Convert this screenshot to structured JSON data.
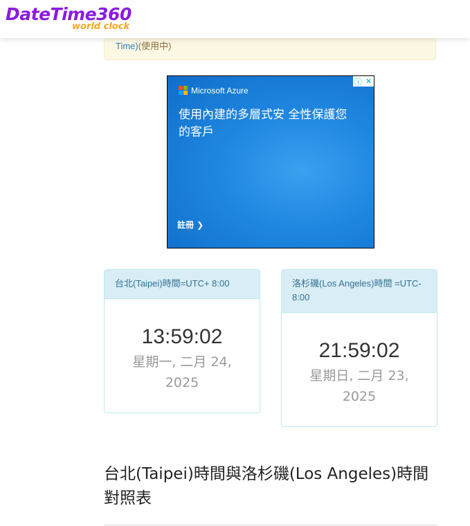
{
  "header": {
    "logo_main": "DateTime360",
    "logo_sub": "world clock"
  },
  "notice": {
    "link_text": "Time)",
    "status_text": "(使用中)"
  },
  "ad": {
    "brand": "Microsoft Azure",
    "headline": "使用內建的多層式安 全性保護您的客戶",
    "cta": "註冊 ❯",
    "info_icon": "ⓘ",
    "close_icon": "✕"
  },
  "clocks": [
    {
      "heading": "台北(Taipei)時間=UTC+ 8:00",
      "time": "13:59:02",
      "date": "星期一, 二月 24, 2025"
    },
    {
      "heading": "洛杉磯(Los Angeles)時間 =UTC- 8:00",
      "time": "21:59:02",
      "date": "星期日, 二月 23, 2025"
    }
  ],
  "section": {
    "title": "台北(Taipei)時間與洛杉磯(Los Angeles)時間對照表"
  },
  "colors": {
    "logo_primary": "#8a1ce0",
    "logo_accent": "#f5a623",
    "panel_heading_bg": "#d9edf7",
    "panel_heading_text": "#31708f",
    "ad_bg": "#1f86e0"
  }
}
